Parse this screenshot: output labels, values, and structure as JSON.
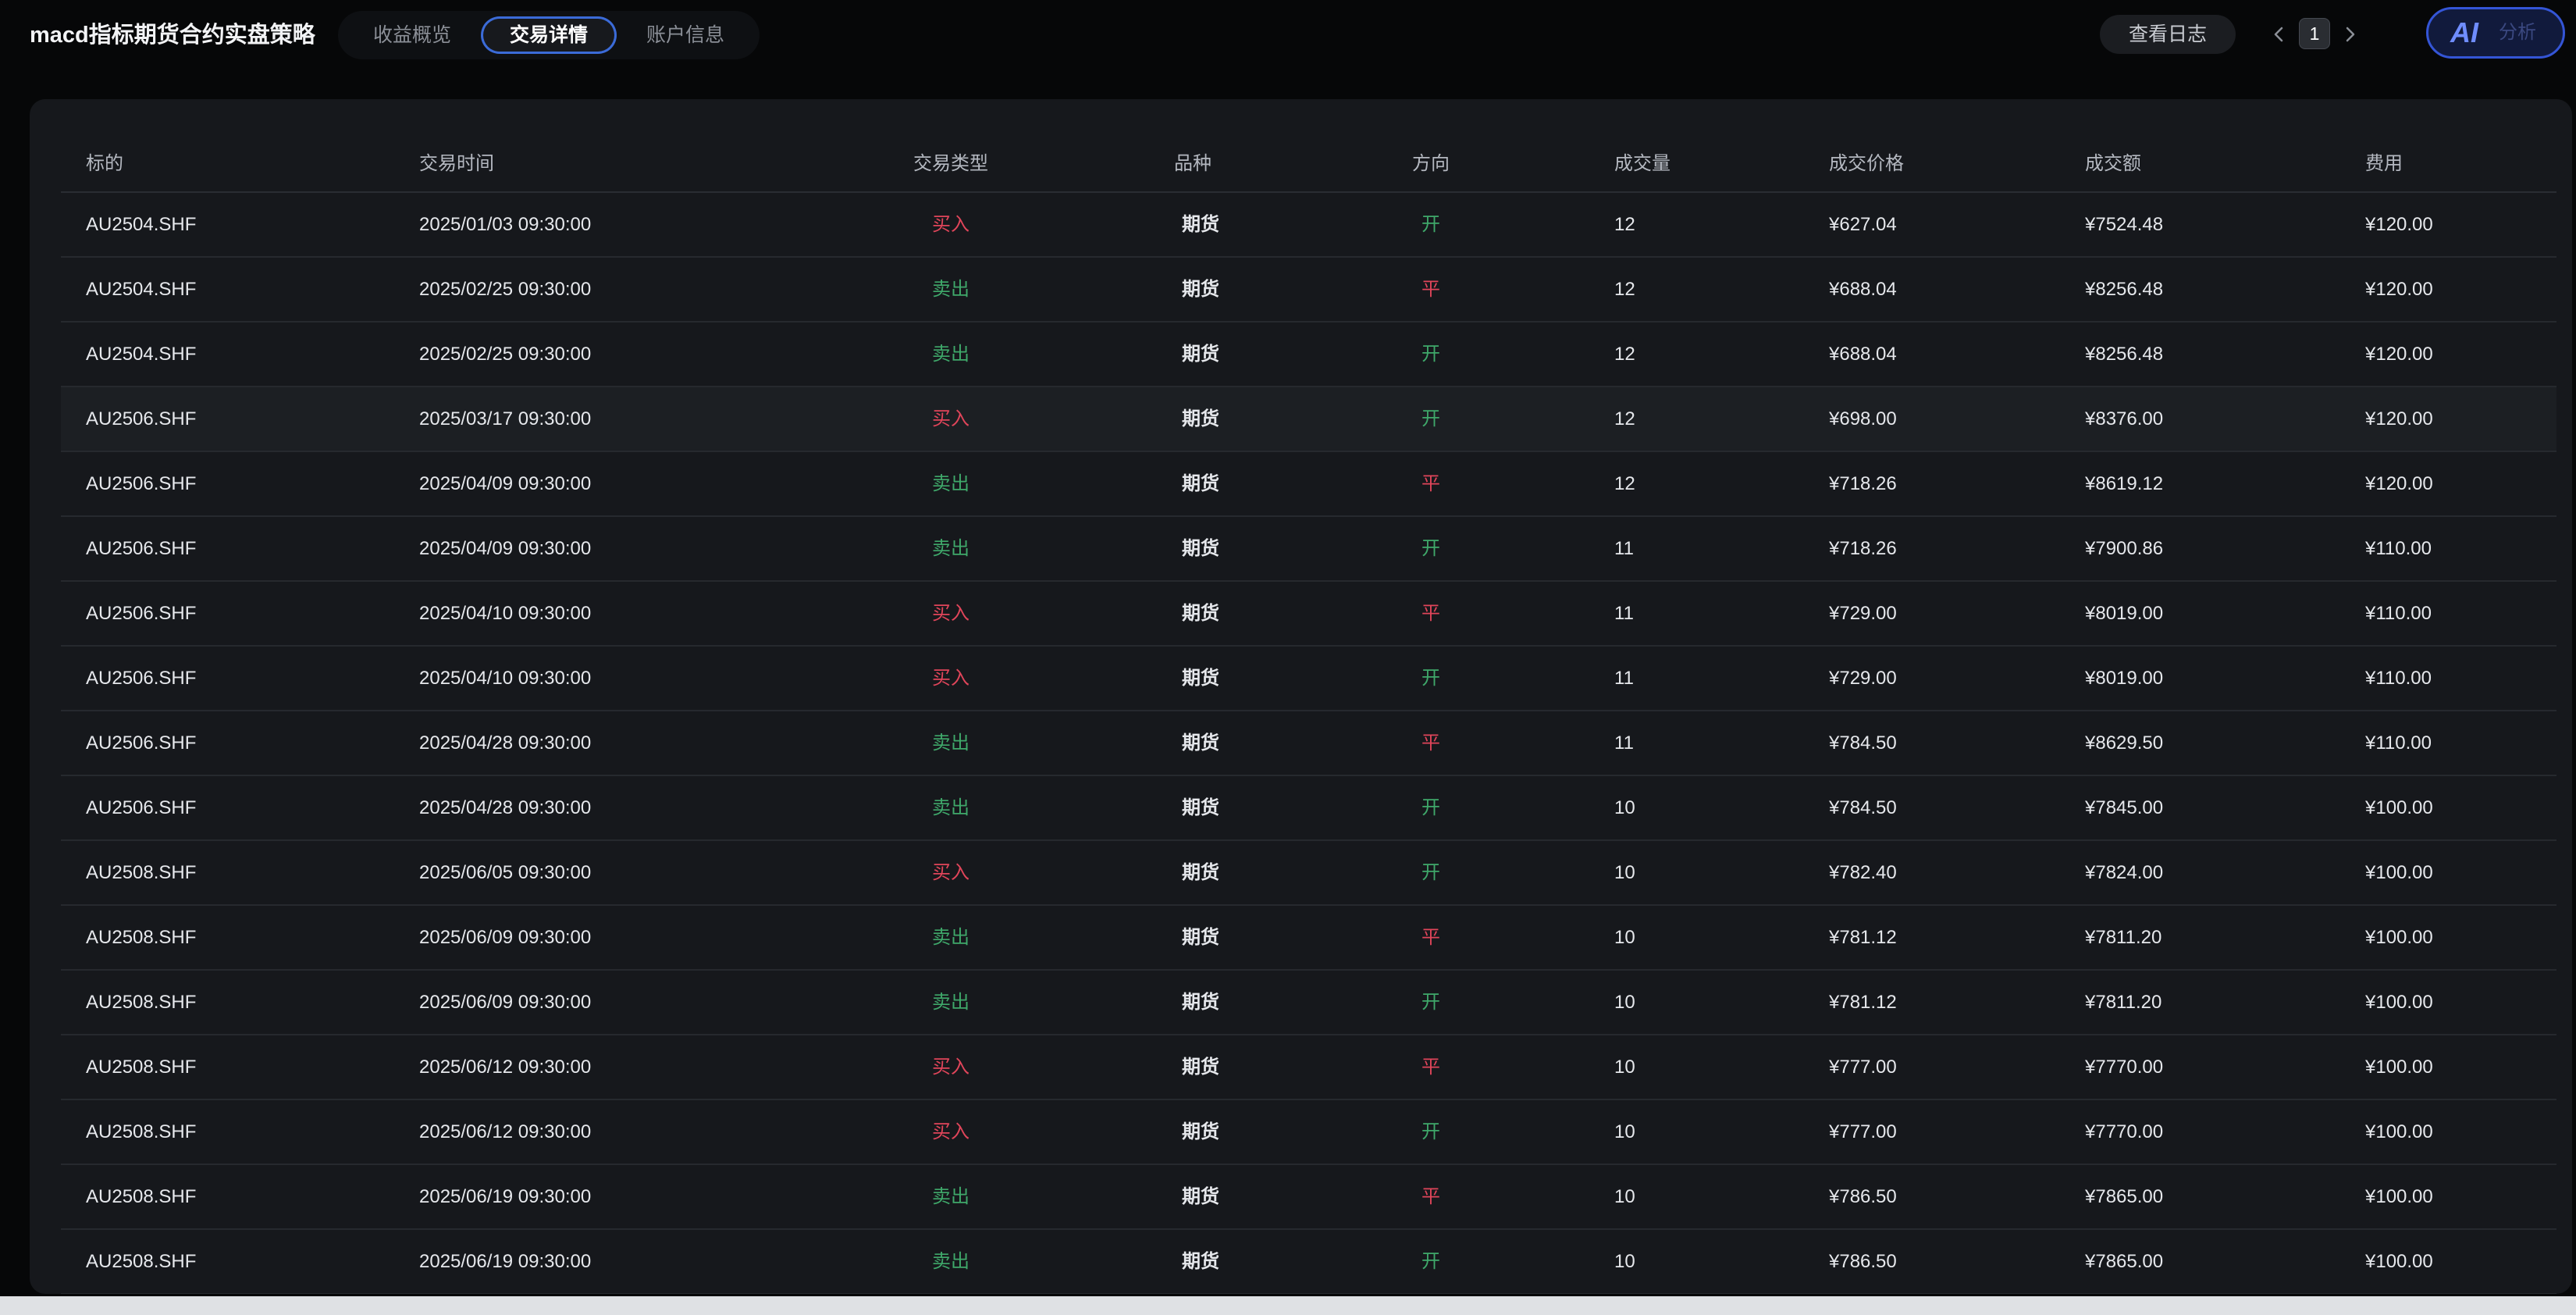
{
  "header": {
    "title": "macd指标期货合约实盘策略",
    "tabs": [
      {
        "label": "收益概览",
        "active": false
      },
      {
        "label": "交易详情",
        "active": true
      },
      {
        "label": "账户信息",
        "active": false
      }
    ],
    "log_button": "查看日志",
    "pager": {
      "current_page": "1",
      "prev_icon": "chevron-left-icon",
      "next_icon": "chevron-right-icon"
    },
    "ai_button": {
      "logo": "AI",
      "label": "分析"
    }
  },
  "colors": {
    "buy": "#e0455a",
    "sell": "#3fa86a",
    "accent": "#3b6bd8",
    "panel": "#16181c",
    "background": "#060708"
  },
  "table": {
    "columns": [
      "标的",
      "交易时间",
      "交易类型",
      "品种",
      "方向",
      "成交量",
      "成交价格",
      "成交额",
      "费用"
    ],
    "rows": [
      {
        "symbol": "AU2504.SHF",
        "time": "2025/01/03 09:30:00",
        "type": "买入",
        "kind": "期货",
        "direction": "开",
        "volume": "12",
        "price": "¥627.04",
        "amount": "¥7524.48",
        "fee": "¥120.00"
      },
      {
        "symbol": "AU2504.SHF",
        "time": "2025/02/25 09:30:00",
        "type": "卖出",
        "kind": "期货",
        "direction": "平",
        "volume": "12",
        "price": "¥688.04",
        "amount": "¥8256.48",
        "fee": "¥120.00"
      },
      {
        "symbol": "AU2504.SHF",
        "time": "2025/02/25 09:30:00",
        "type": "卖出",
        "kind": "期货",
        "direction": "开",
        "volume": "12",
        "price": "¥688.04",
        "amount": "¥8256.48",
        "fee": "¥120.00"
      },
      {
        "symbol": "AU2506.SHF",
        "time": "2025/03/17 09:30:00",
        "type": "买入",
        "kind": "期货",
        "direction": "开",
        "volume": "12",
        "price": "¥698.00",
        "amount": "¥8376.00",
        "fee": "¥120.00"
      },
      {
        "symbol": "AU2506.SHF",
        "time": "2025/04/09 09:30:00",
        "type": "卖出",
        "kind": "期货",
        "direction": "平",
        "volume": "12",
        "price": "¥718.26",
        "amount": "¥8619.12",
        "fee": "¥120.00"
      },
      {
        "symbol": "AU2506.SHF",
        "time": "2025/04/09 09:30:00",
        "type": "卖出",
        "kind": "期货",
        "direction": "开",
        "volume": "11",
        "price": "¥718.26",
        "amount": "¥7900.86",
        "fee": "¥110.00"
      },
      {
        "symbol": "AU2506.SHF",
        "time": "2025/04/10 09:30:00",
        "type": "买入",
        "kind": "期货",
        "direction": "平",
        "volume": "11",
        "price": "¥729.00",
        "amount": "¥8019.00",
        "fee": "¥110.00"
      },
      {
        "symbol": "AU2506.SHF",
        "time": "2025/04/10 09:30:00",
        "type": "买入",
        "kind": "期货",
        "direction": "开",
        "volume": "11",
        "price": "¥729.00",
        "amount": "¥8019.00",
        "fee": "¥110.00"
      },
      {
        "symbol": "AU2506.SHF",
        "time": "2025/04/28 09:30:00",
        "type": "卖出",
        "kind": "期货",
        "direction": "平",
        "volume": "11",
        "price": "¥784.50",
        "amount": "¥8629.50",
        "fee": "¥110.00"
      },
      {
        "symbol": "AU2506.SHF",
        "time": "2025/04/28 09:30:00",
        "type": "卖出",
        "kind": "期货",
        "direction": "开",
        "volume": "10",
        "price": "¥784.50",
        "amount": "¥7845.00",
        "fee": "¥100.00"
      },
      {
        "symbol": "AU2508.SHF",
        "time": "2025/06/05 09:30:00",
        "type": "买入",
        "kind": "期货",
        "direction": "开",
        "volume": "10",
        "price": "¥782.40",
        "amount": "¥7824.00",
        "fee": "¥100.00"
      },
      {
        "symbol": "AU2508.SHF",
        "time": "2025/06/09 09:30:00",
        "type": "卖出",
        "kind": "期货",
        "direction": "平",
        "volume": "10",
        "price": "¥781.12",
        "amount": "¥7811.20",
        "fee": "¥100.00"
      },
      {
        "symbol": "AU2508.SHF",
        "time": "2025/06/09 09:30:00",
        "type": "卖出",
        "kind": "期货",
        "direction": "开",
        "volume": "10",
        "price": "¥781.12",
        "amount": "¥7811.20",
        "fee": "¥100.00"
      },
      {
        "symbol": "AU2508.SHF",
        "time": "2025/06/12 09:30:00",
        "type": "买入",
        "kind": "期货",
        "direction": "平",
        "volume": "10",
        "price": "¥777.00",
        "amount": "¥7770.00",
        "fee": "¥100.00"
      },
      {
        "symbol": "AU2508.SHF",
        "time": "2025/06/12 09:30:00",
        "type": "买入",
        "kind": "期货",
        "direction": "开",
        "volume": "10",
        "price": "¥777.00",
        "amount": "¥7770.00",
        "fee": "¥100.00"
      },
      {
        "symbol": "AU2508.SHF",
        "time": "2025/06/19 09:30:00",
        "type": "卖出",
        "kind": "期货",
        "direction": "平",
        "volume": "10",
        "price": "¥786.50",
        "amount": "¥7865.00",
        "fee": "¥100.00"
      },
      {
        "symbol": "AU2508.SHF",
        "time": "2025/06/19 09:30:00",
        "type": "卖出",
        "kind": "期货",
        "direction": "开",
        "volume": "10",
        "price": "¥786.50",
        "amount": "¥7865.00",
        "fee": "¥100.00"
      }
    ]
  }
}
